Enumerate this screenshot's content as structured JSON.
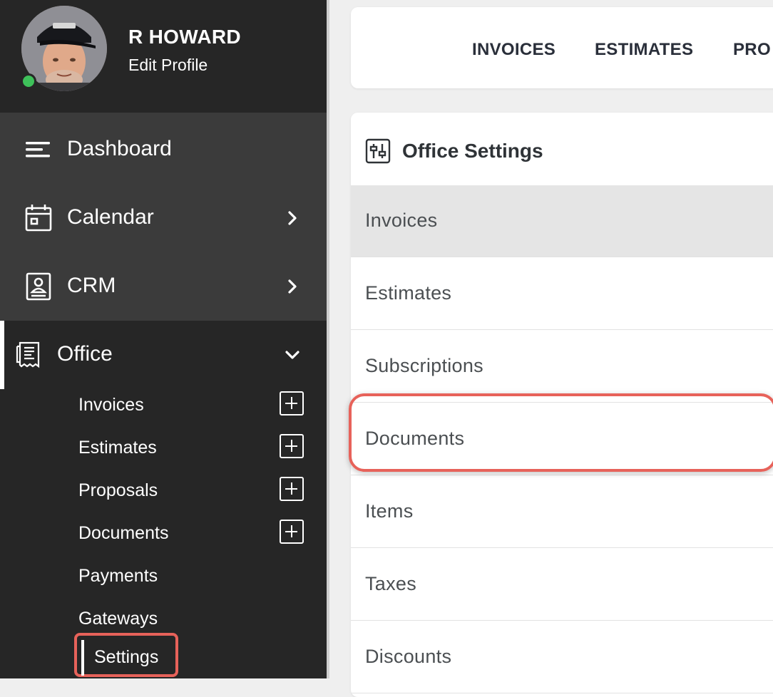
{
  "profile": {
    "name": "R HOWARD",
    "edit_label": "Edit Profile",
    "status": "online",
    "status_color": "#3ec15a"
  },
  "sidebar": {
    "items": [
      {
        "label": "Dashboard",
        "icon": "menu-lines-icon"
      },
      {
        "label": "Calendar",
        "icon": "calendar-icon",
        "has_chevron": true
      },
      {
        "label": "CRM",
        "icon": "contact-book-icon",
        "has_chevron": true
      },
      {
        "label": "Office",
        "icon": "receipt-icon",
        "expanded": true
      }
    ],
    "office_subitems": [
      {
        "label": "Invoices",
        "has_add": true
      },
      {
        "label": "Estimates",
        "has_add": true
      },
      {
        "label": "Proposals",
        "has_add": true
      },
      {
        "label": "Documents",
        "has_add": true
      },
      {
        "label": "Payments",
        "has_add": false
      },
      {
        "label": "Gateways",
        "has_add": false
      },
      {
        "label": "Settings",
        "has_add": false,
        "highlighted": true
      }
    ]
  },
  "top_tabs": [
    "INVOICES",
    "ESTIMATES",
    "PRO"
  ],
  "settings_card": {
    "title": "Office Settings",
    "icon": "sliders-icon",
    "rows": [
      {
        "label": "Invoices",
        "active": true
      },
      {
        "label": "Estimates"
      },
      {
        "label": "Subscriptions"
      },
      {
        "label": "Documents",
        "highlighted": true
      },
      {
        "label": "Items"
      },
      {
        "label": "Taxes"
      },
      {
        "label": "Discounts"
      }
    ]
  },
  "colors": {
    "sidebar_bg": "#262626",
    "sidebar_top_bg": "#3b3b3b",
    "highlight": "#e7625a",
    "active_row": "#e5e5e5",
    "page_bg": "#efefef"
  }
}
